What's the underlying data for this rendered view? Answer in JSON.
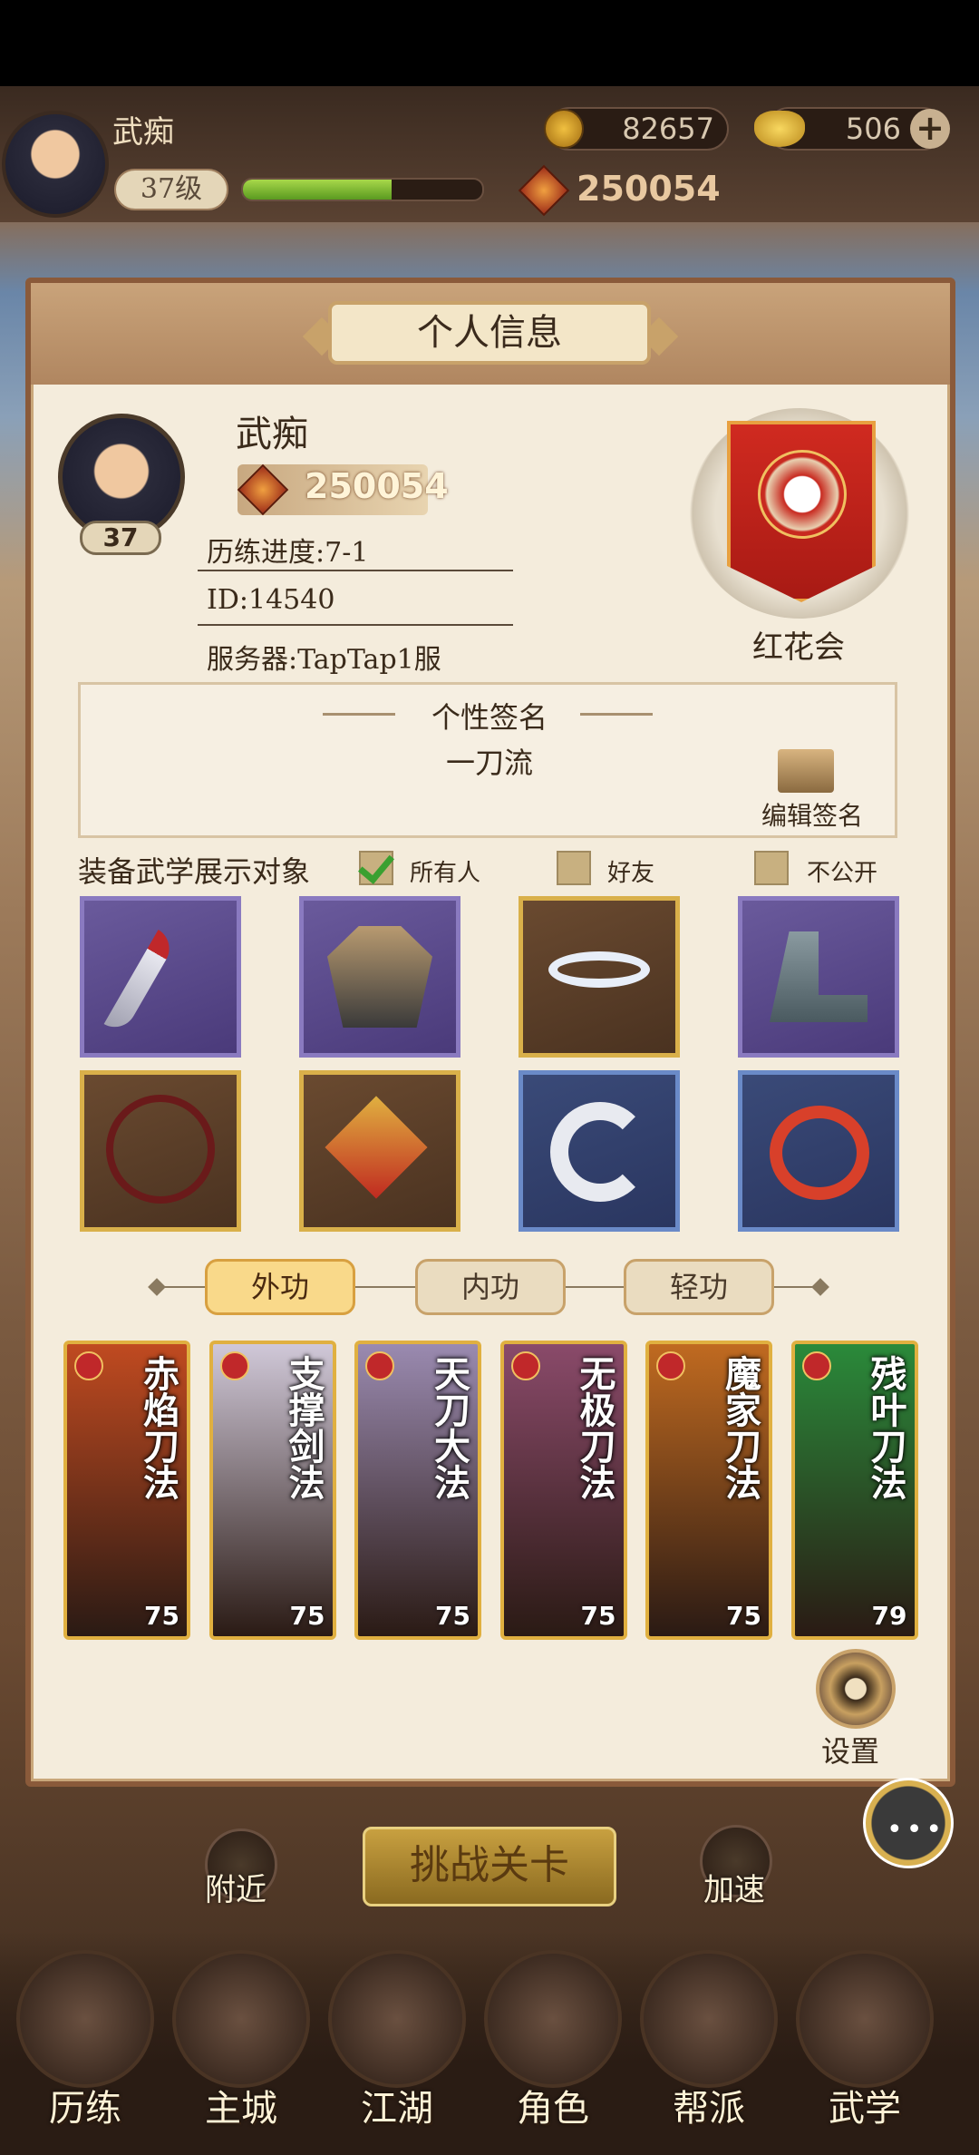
{
  "top": {
    "player_name": "武痴",
    "level_label": "37级",
    "level_progress": 0.62,
    "coins": "82657",
    "ingots": "506",
    "power": "250054"
  },
  "panel": {
    "title": "个人信息",
    "name": "武痴",
    "power": "250054",
    "avatar_level": "37",
    "progress_text": "历练进度:7-1",
    "id_text": "ID:14540",
    "server_text": "服务器:TapTap1服",
    "guild_name": "红花会",
    "signature_heading": "个性签名",
    "signature_text": "一刀流",
    "edit_signature": "编辑签名",
    "display_label": "装备武学展示对象",
    "visibility": [
      {
        "label": "所有人",
        "checked": true
      },
      {
        "label": "好友",
        "checked": false
      },
      {
        "label": "不公开",
        "checked": false
      }
    ],
    "equipment_icons": [
      "saber-icon",
      "robe-icon",
      "belt-icon",
      "boots-icon",
      "necklace-icon",
      "hairpin-icon",
      "ring-icon",
      "bracelet-icon"
    ],
    "tabs": [
      "外功",
      "内功",
      "轻功"
    ],
    "active_tab": "外功",
    "skills": [
      {
        "name": "赤焰刀法",
        "level": "75",
        "color": "#c04a20"
      },
      {
        "name": "支撑剑法",
        "level": "75",
        "color": "#d0c8d8"
      },
      {
        "name": "天刀大法",
        "level": "75",
        "color": "#9a8ab0"
      },
      {
        "name": "无极刀法",
        "level": "75",
        "color": "#8a4a6a"
      },
      {
        "name": "魔家刀法",
        "level": "75",
        "color": "#c06a20"
      },
      {
        "name": "残叶刀法",
        "level": "79",
        "color": "#2a8a3a"
      }
    ],
    "settings_label": "设置"
  },
  "buttons": {
    "nearby": "附近",
    "challenge": "挑战关卡",
    "speedup": "加速"
  },
  "bottom_nav": [
    "历练",
    "主城",
    "江湖",
    "角色",
    "帮派",
    "武学"
  ]
}
